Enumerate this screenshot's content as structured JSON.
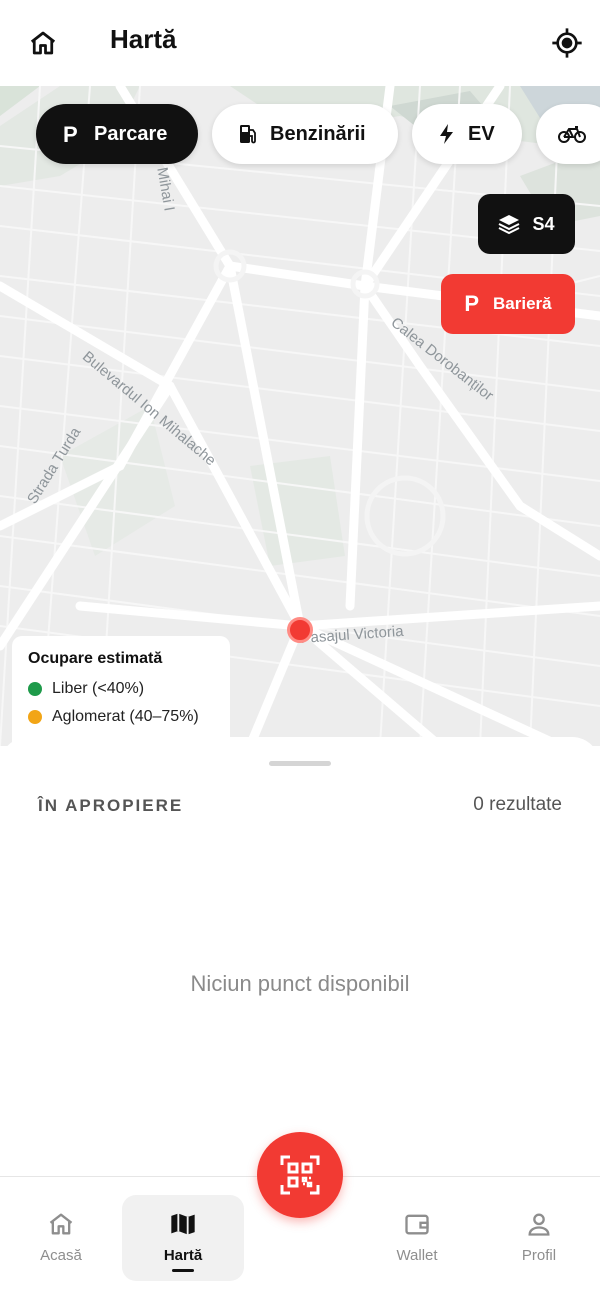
{
  "header": {
    "title": "Hartă"
  },
  "filters": [
    {
      "label": "Parcare",
      "icon": "parking-icon",
      "active": true
    },
    {
      "label": "Benzinării",
      "icon": "fuel-pump-icon",
      "active": false
    },
    {
      "label": "EV",
      "icon": "lightning-icon",
      "active": false
    },
    {
      "label": "",
      "icon": "bicycle-icon",
      "active": false
    }
  ],
  "map": {
    "layer_button": "S4",
    "bariera_button": {
      "icon_text": "P",
      "label": "Barieră"
    },
    "street_labels": [
      "Mihai I",
      "Calea Dorobanților",
      "Bulevardul Ion Mihalache",
      "Strada Turda",
      "Pasajul Victoria"
    ],
    "legend": {
      "title": "Ocupare estimată",
      "items": [
        {
          "label": "Liber (<40%)",
          "color": "#1e9a4a"
        },
        {
          "label": "Aglomerat (40–75%)",
          "color": "#f2a516"
        }
      ]
    }
  },
  "sheet": {
    "section_title": "ÎN APROPIERE",
    "results_count": "0 rezultate",
    "empty_text": "Niciun punct disponibil"
  },
  "nav": {
    "items": [
      {
        "label": "Acasă"
      },
      {
        "label": "Hartă"
      },
      {
        "label": "Wallet"
      },
      {
        "label": "Profil"
      }
    ]
  },
  "colors": {
    "accent": "#f23a33",
    "dark": "#111111"
  }
}
